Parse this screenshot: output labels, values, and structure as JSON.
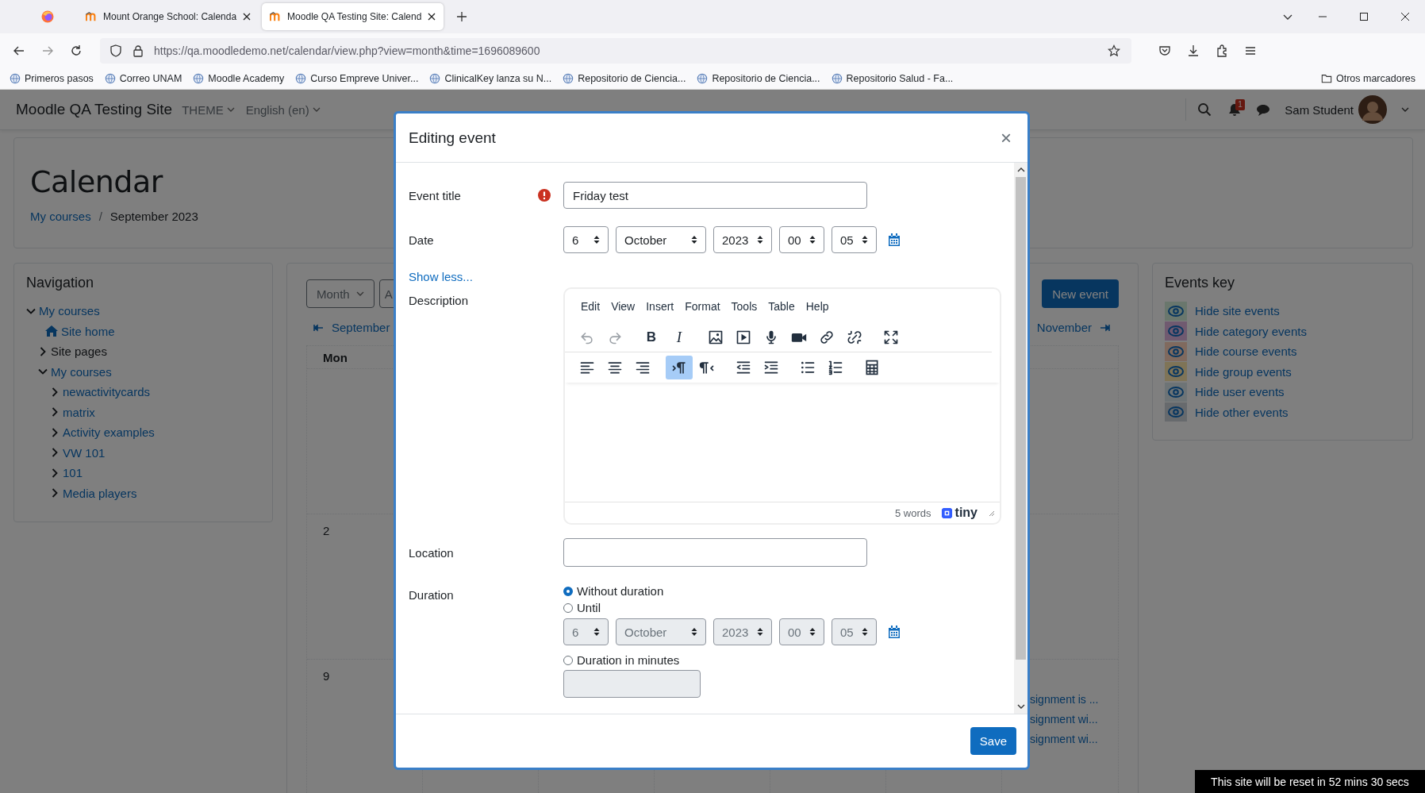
{
  "browser": {
    "tabs": [
      {
        "title": "Mount Orange School: Calenda",
        "selected": false
      },
      {
        "title": "Moodle QA Testing Site: Calend",
        "selected": true
      }
    ],
    "url": "https://qa.moodledemo.net/calendar/view.php?view=month&time=1696089600",
    "bookmarks": [
      {
        "label": "Primeros pasos"
      },
      {
        "label": "Correo UNAM"
      },
      {
        "label": "Moodle Academy"
      },
      {
        "label": "Curso Empreve Univer..."
      },
      {
        "label": "ClinicalKey lanza su N..."
      },
      {
        "label": "Repositorio de Ciencia..."
      },
      {
        "label": "Repositorio de Ciencia..."
      },
      {
        "label": "Repositorio Salud - Fa..."
      }
    ],
    "other_bookmarks": "Otros marcadores"
  },
  "navbar": {
    "site_name": "Moodle QA Testing Site",
    "menus": [
      "THEME",
      "English (en)"
    ],
    "notification_count": "1",
    "user_name": "Sam Student"
  },
  "header": {
    "title": "Calendar",
    "separator": "/",
    "breadcrumb": [
      {
        "label": "My courses",
        "link": true
      },
      {
        "label": "September 2023",
        "link": false
      }
    ]
  },
  "navigation": {
    "title": "Navigation",
    "items": [
      {
        "label": "My courses",
        "kind": "branch",
        "expanded": true,
        "link": true,
        "children": [
          {
            "label": "Site home",
            "kind": "home",
            "link": true
          },
          {
            "label": "Site pages",
            "kind": "branch",
            "expanded": false,
            "link": false
          },
          {
            "label": "My courses",
            "kind": "branch",
            "expanded": true,
            "link": true,
            "children": [
              {
                "label": "newactivitycards",
                "kind": "branch",
                "expanded": false,
                "link": true
              },
              {
                "label": "matrix",
                "kind": "branch",
                "expanded": false,
                "link": true
              },
              {
                "label": "Activity examples",
                "kind": "branch",
                "expanded": false,
                "link": true
              },
              {
                "label": "VW 101",
                "kind": "branch",
                "expanded": false,
                "link": true
              },
              {
                "label": "101",
                "kind": "branch",
                "expanded": false,
                "link": true
              },
              {
                "label": "Media players",
                "kind": "branch",
                "expanded": false,
                "link": true
              }
            ]
          }
        ]
      }
    ]
  },
  "calendar": {
    "view_button": "Month",
    "second_button": "A",
    "new_event": "New event",
    "prev_month": "September",
    "next_month": "November",
    "column_1": "Mon",
    "weeks": [
      {
        "kind": "blank"
      },
      {
        "kind": "day",
        "day": "2"
      },
      {
        "kind": "day",
        "day": "9",
        "events": [
          "signment is ...",
          "signment wi...",
          "signment wi..."
        ]
      }
    ]
  },
  "events_key": {
    "title": "Events key",
    "items": [
      {
        "label": "Hide site events",
        "color": "#6a776d"
      },
      {
        "label": "Hide category events",
        "color": "#705a70"
      },
      {
        "label": "Hide course events",
        "color": "#806a5e"
      },
      {
        "label": "Hide group events",
        "color": "#7f7457"
      },
      {
        "label": "Hide user events",
        "color": "#6e7476"
      },
      {
        "label": "Hide other events",
        "color": "#676a6d"
      }
    ]
  },
  "modal": {
    "title": "Editing event",
    "close": "×",
    "event_title": {
      "label": "Event title",
      "value": "Friday test",
      "error": true
    },
    "date": {
      "label": "Date",
      "fields": [
        "6",
        "October",
        "2023",
        "00",
        "05"
      ]
    },
    "show_less": "Show less...",
    "description": {
      "label": "Description",
      "menu": [
        "Edit",
        "View",
        "Insert",
        "Format",
        "Tools",
        "Table",
        "Help"
      ],
      "toolbar": [
        {
          "groups": [
            {
              "buttons": [
                {
                  "kind": "undo",
                  "disabled": true,
                  "active": false
                },
                {
                  "kind": "redo",
                  "disabled": true,
                  "active": false
                }
              ]
            },
            {
              "buttons": [
                {
                  "kind": "bold",
                  "label": "B",
                  "disabled": false,
                  "active": false
                },
                {
                  "kind": "italic",
                  "label": "I",
                  "disabled": false,
                  "active": false
                }
              ]
            },
            {
              "buttons": [
                {
                  "kind": "image",
                  "disabled": false,
                  "active": false
                },
                {
                  "kind": "media",
                  "disabled": false,
                  "active": false
                },
                {
                  "kind": "mic",
                  "disabled": false,
                  "active": false
                },
                {
                  "kind": "video",
                  "disabled": false,
                  "active": false
                },
                {
                  "kind": "link",
                  "disabled": false,
                  "active": false
                },
                {
                  "kind": "unlink",
                  "disabled": false,
                  "active": false
                }
              ]
            },
            {
              "buttons": [
                {
                  "kind": "fullscreen",
                  "disabled": false,
                  "active": false
                }
              ]
            }
          ]
        },
        {
          "groups": [
            {
              "buttons": [
                {
                  "kind": "alignleft",
                  "disabled": false,
                  "active": false
                },
                {
                  "kind": "aligncenter",
                  "disabled": false,
                  "active": false
                },
                {
                  "kind": "alignright",
                  "disabled": false,
                  "active": false
                }
              ]
            },
            {
              "buttons": [
                {
                  "kind": "ltr",
                  "disabled": false,
                  "active": true
                },
                {
                  "kind": "rtl",
                  "disabled": false,
                  "active": false
                }
              ]
            },
            {
              "buttons": [
                {
                  "kind": "outdent",
                  "disabled": false,
                  "active": false
                },
                {
                  "kind": "indent",
                  "disabled": false,
                  "active": false
                }
              ]
            },
            {
              "buttons": [
                {
                  "kind": "bullist",
                  "disabled": false,
                  "active": false
                },
                {
                  "kind": "numlist",
                  "disabled": false,
                  "active": false
                }
              ]
            },
            {
              "buttons": [
                {
                  "kind": "table",
                  "disabled": false,
                  "active": false
                }
              ]
            }
          ]
        }
      ],
      "word_count": "5 words",
      "brand": "tiny"
    },
    "location": {
      "label": "Location"
    },
    "duration": {
      "label": "Duration",
      "options": [
        {
          "label": "Without duration",
          "selected": true
        },
        {
          "label": "Until",
          "selected": false
        },
        {
          "label": "Duration in minutes",
          "selected": false
        }
      ],
      "until_fields": [
        "6",
        "October",
        "2023",
        "00",
        "05"
      ],
      "until_disabled": true,
      "minutes_disabled": true
    },
    "save": "Save"
  },
  "reset_notice": "This site will be reset in 52 mins 30 secs"
}
